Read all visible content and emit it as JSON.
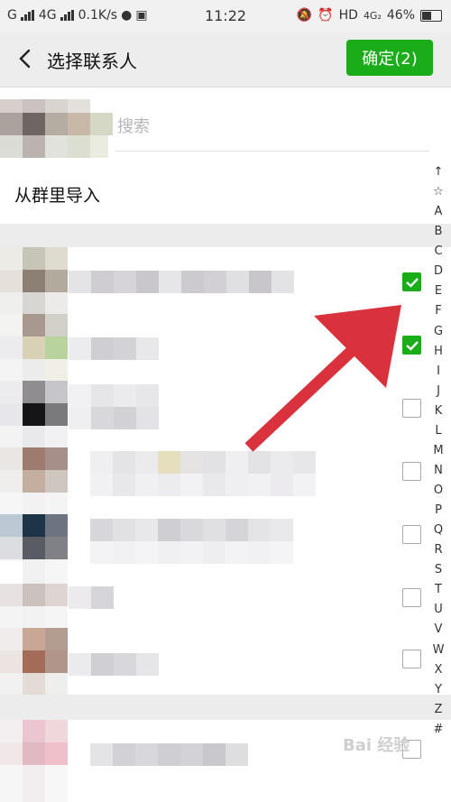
{
  "status_bar": {
    "carrier1": "G",
    "carrier2": "4G",
    "speed": "0.1K/s",
    "time": "11:22",
    "network": "HD",
    "network_sub": "4G₂",
    "battery": "46%"
  },
  "nav": {
    "title": "选择联系人",
    "confirm_label": "确定(2)"
  },
  "search": {
    "placeholder": "搜索"
  },
  "group_import": {
    "label": "从群里导入"
  },
  "contacts": [
    {
      "checked": true
    },
    {
      "checked": true
    },
    {
      "checked": false
    },
    {
      "checked": false
    },
    {
      "checked": false
    },
    {
      "checked": false
    },
    {
      "checked": false
    },
    {
      "checked": false
    }
  ],
  "index_letters": [
    "↑",
    "☆",
    "A",
    "B",
    "C",
    "D",
    "E",
    "F",
    "G",
    "H",
    "I",
    "J",
    "K",
    "L",
    "M",
    "N",
    "O",
    "P",
    "Q",
    "R",
    "S",
    "T",
    "U",
    "V",
    "W",
    "X",
    "Y",
    "Z",
    "#"
  ],
  "watermark": "Bai 经验",
  "colors": {
    "accent": "#1aad19",
    "annotation_arrow": "#d9323c"
  }
}
